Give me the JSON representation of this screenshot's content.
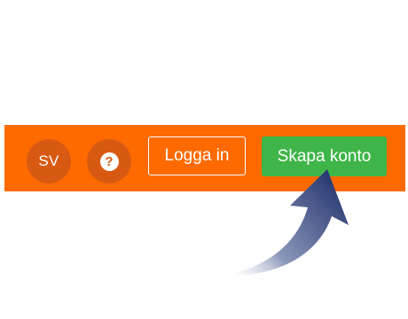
{
  "header": {
    "language_label": "SV",
    "help_icon": "question-mark-icon",
    "help_glyph": "?",
    "login_label": "Logga in",
    "signup_label": "Skapa konto"
  },
  "colors": {
    "header_bg": "#ff6a00",
    "circle_button_bg": "#d85a12",
    "signup_bg": "#3fb549",
    "arrow_color": "#1f2f6b"
  },
  "annotation": {
    "icon": "curved-arrow-icon"
  }
}
